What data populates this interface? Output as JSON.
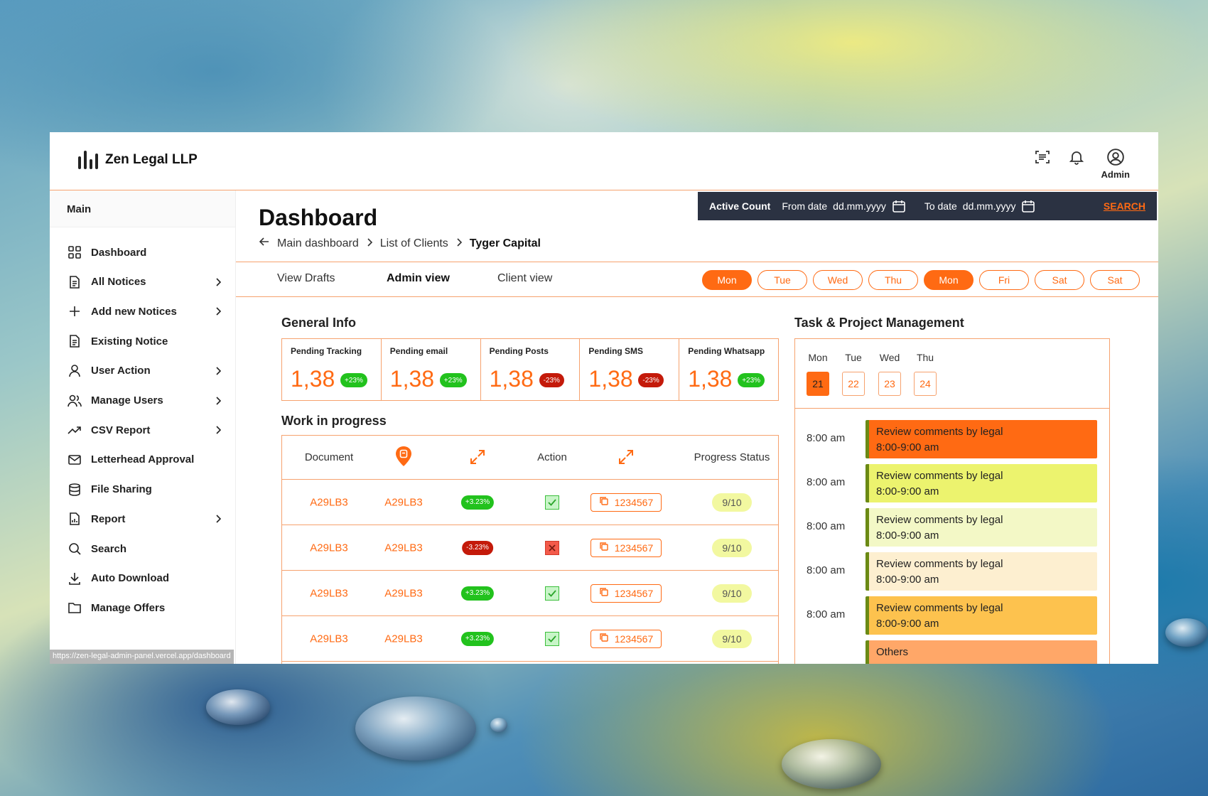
{
  "app": {
    "brand": "Zen Legal LLP",
    "user_label": "Admin",
    "status_url": "https://zen-legal-admin-panel.vercel.app/dashboard"
  },
  "sidebar": {
    "heading": "Main",
    "items": [
      {
        "label": "Dashboard",
        "icon": "grid-icon",
        "chevron": false
      },
      {
        "label": "All Notices",
        "icon": "document-icon",
        "chevron": true
      },
      {
        "label": "Add new Notices",
        "icon": "plus-icon",
        "chevron": true
      },
      {
        "label": "Existing Notice",
        "icon": "document-icon",
        "chevron": false
      },
      {
        "label": "User Action",
        "icon": "user-icon",
        "chevron": true
      },
      {
        "label": "Manage Users",
        "icon": "users-icon",
        "chevron": true
      },
      {
        "label": "CSV Report",
        "icon": "trend-icon",
        "chevron": true
      },
      {
        "label": "Letterhead Approval",
        "icon": "mail-icon",
        "chevron": false
      },
      {
        "label": "File Sharing",
        "icon": "database-icon",
        "chevron": false
      },
      {
        "label": "Report",
        "icon": "report-icon",
        "chevron": true
      },
      {
        "label": "Search",
        "icon": "search-icon",
        "chevron": false
      },
      {
        "label": "Auto Download",
        "icon": "download-icon",
        "chevron": false
      },
      {
        "label": "Manage Offers",
        "icon": "folder-icon",
        "chevron": false
      }
    ]
  },
  "header": {
    "title": "Dashboard",
    "breadcrumb": [
      "Main dashboard",
      "List of Clients",
      "Tyger Capital"
    ]
  },
  "active_count": {
    "title": "Active Count",
    "from_label": "From date",
    "from_value": "dd.mm.yyyy",
    "to_label": "To date",
    "to_value": "dd.mm.yyyy",
    "search_label": "SEARCH"
  },
  "tabs": [
    "View Drafts",
    "Admin view",
    "Client view"
  ],
  "active_tab": "Admin view",
  "day_filters": [
    {
      "label": "Mon",
      "on": true
    },
    {
      "label": "Tue",
      "on": false
    },
    {
      "label": "Wed",
      "on": false
    },
    {
      "label": "Thu",
      "on": false
    },
    {
      "label": "Mon",
      "on": true
    },
    {
      "label": "Fri",
      "on": false
    },
    {
      "label": "Sat",
      "on": false
    },
    {
      "label": "Sat",
      "on": false
    }
  ],
  "general_info": {
    "title": "General Info",
    "cards": [
      {
        "label": "Pending Tracking",
        "value": "1,38",
        "change": "+23%",
        "trend": "up"
      },
      {
        "label": "Pending email",
        "value": "1,38",
        "change": "+23%",
        "trend": "up"
      },
      {
        "label": "Pending Posts",
        "value": "1,38",
        "change": "-23%",
        "trend": "down"
      },
      {
        "label": "Pending SMS",
        "value": "1,38",
        "change": "-23%",
        "trend": "down"
      },
      {
        "label": "Pending Whatsapp",
        "value": "1,38",
        "change": "+23%",
        "trend": "up"
      }
    ]
  },
  "wip": {
    "title": "Work in progress",
    "headers": {
      "document": "Document",
      "action": "Action",
      "progress": "Progress Status"
    },
    "rows": [
      {
        "doc": "A29LB3",
        "ref": "A29LB3",
        "change": "+3.23%",
        "trend": "up",
        "approved": true,
        "copy_value": "1234567",
        "progress": "9/10"
      },
      {
        "doc": "A29LB3",
        "ref": "A29LB3",
        "change": "-3.23%",
        "trend": "down",
        "approved": false,
        "copy_value": "1234567",
        "progress": "9/10"
      },
      {
        "doc": "A29LB3",
        "ref": "A29LB3",
        "change": "+3.23%",
        "trend": "up",
        "approved": true,
        "copy_value": "1234567",
        "progress": "9/10"
      },
      {
        "doc": "A29LB3",
        "ref": "A29LB3",
        "change": "+3.23%",
        "trend": "up",
        "approved": true,
        "copy_value": "1234567",
        "progress": "9/10"
      }
    ]
  },
  "tasks": {
    "title": "Task & Project Management",
    "days": [
      {
        "name": "Mon",
        "num": "21",
        "on": true
      },
      {
        "name": "Tue",
        "num": "22",
        "on": false
      },
      {
        "name": "Wed",
        "num": "23",
        "on": false
      },
      {
        "name": "Thu",
        "num": "24",
        "on": false
      }
    ],
    "events": [
      {
        "time": "8:00 am",
        "title": "Review comments by legal",
        "range": "8:00-9:00 am",
        "color": "#ff6a13"
      },
      {
        "time": "8:00 am",
        "title": "Review comments by legal",
        "range": "8:00-9:00 am",
        "color": "#ecf36e"
      },
      {
        "time": "8:00 am",
        "title": "Review comments by legal",
        "range": "8:00-9:00 am",
        "color": "#f3f8c6"
      },
      {
        "time": "8:00 am",
        "title": "Review comments by legal",
        "range": "8:00-9:00 am",
        "color": "#fdefd0"
      },
      {
        "time": "8:00 am",
        "title": "Review comments by legal",
        "range": "8:00-9:00 am",
        "color": "#fdc24e"
      },
      {
        "time": "",
        "title": "Others",
        "range": "",
        "color": "#ffa768"
      }
    ]
  }
}
